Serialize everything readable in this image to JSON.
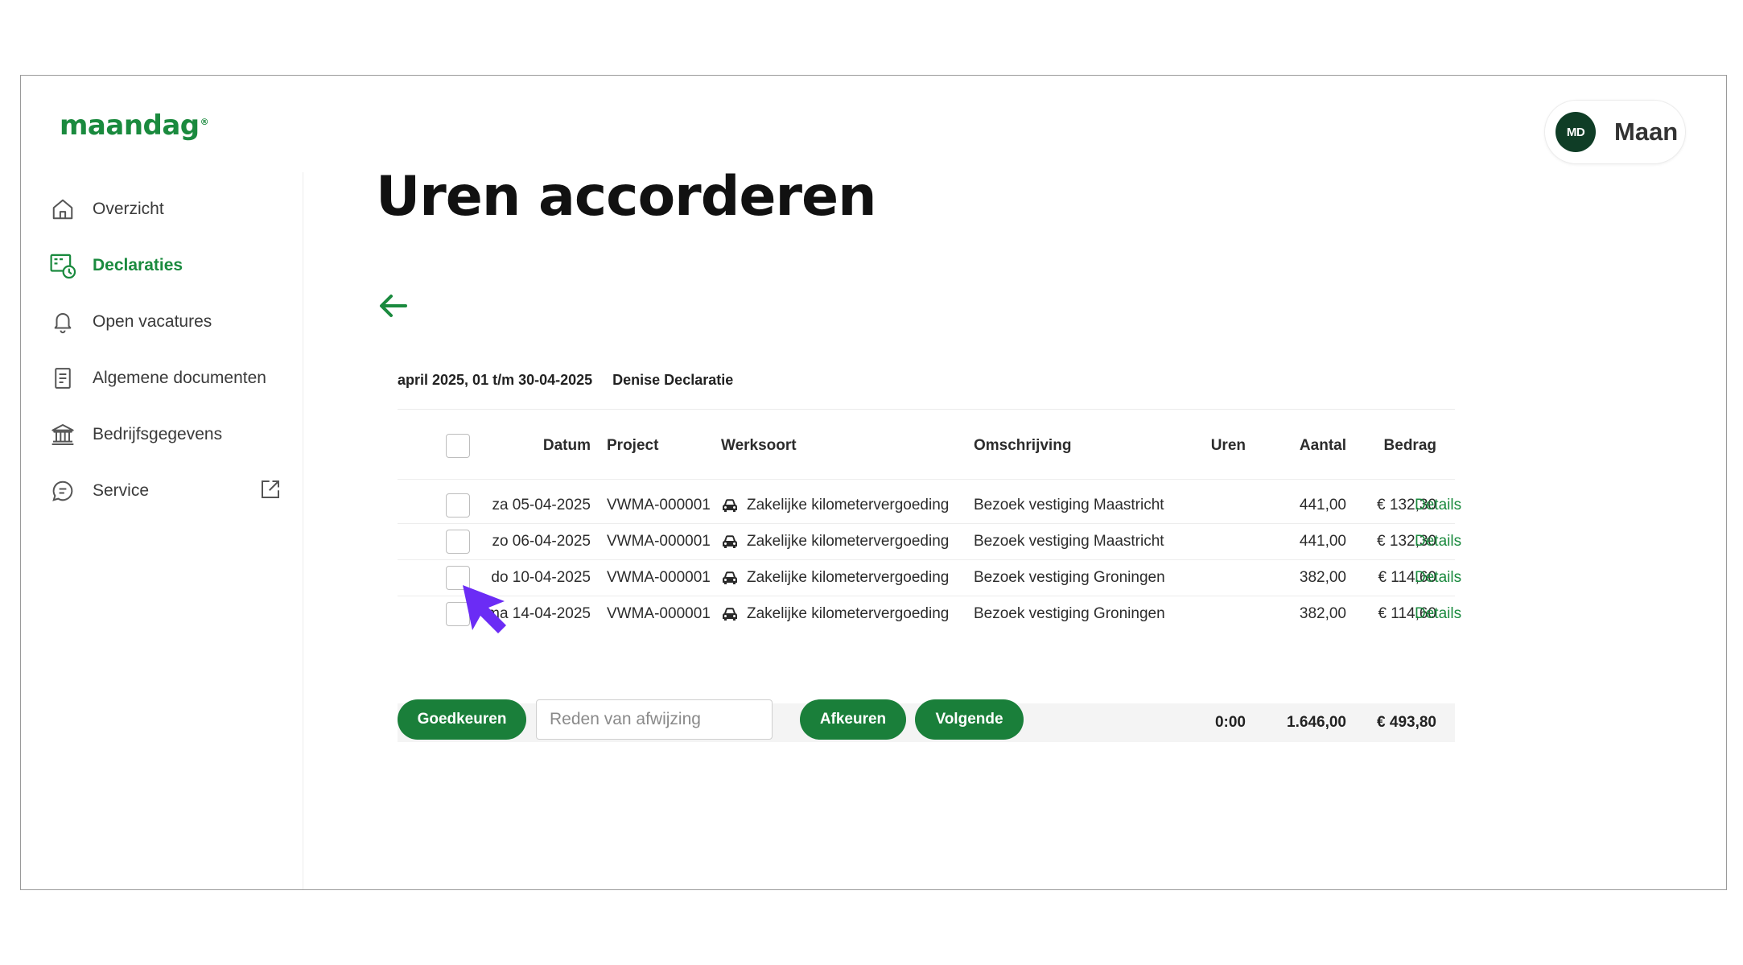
{
  "app": {
    "logo": "maandag",
    "logo_mark": "®",
    "user": {
      "initials": "MD",
      "name": "Maan"
    }
  },
  "sidebar": {
    "items": [
      {
        "label": "Overzicht",
        "icon": "home-icon"
      },
      {
        "label": "Declaraties",
        "icon": "declarations-clock-icon",
        "active": true
      },
      {
        "label": "Open vacatures",
        "icon": "bell-icon"
      },
      {
        "label": "Algemene documenten",
        "icon": "document-icon"
      },
      {
        "label": "Bedrijfsgegevens",
        "icon": "bank-icon"
      },
      {
        "label": "Service",
        "icon": "chat-icon",
        "external": "external-link-icon"
      }
    ]
  },
  "main": {
    "title": "Uren accorderen",
    "period": "april 2025, 01 t/m 30-04-2025",
    "declaration_name": "Denise Declaratie",
    "table": {
      "columns": [
        "Datum",
        "Project",
        "Werksoort",
        "Omschrijving",
        "Uren",
        "Aantal",
        "Bedrag"
      ],
      "rows": [
        {
          "datum": "za 05-04-2025",
          "project": "VWMA-000001",
          "werksoort": "Zakelijke kilometervergoeding",
          "omschrijving": "Bezoek vestiging Maastricht",
          "uren": "",
          "aantal": "441,00",
          "bedrag": "€ 132,30",
          "link": "Details"
        },
        {
          "datum": "zo 06-04-2025",
          "project": "VWMA-000001",
          "werksoort": "Zakelijke kilometervergoeding",
          "omschrijving": "Bezoek vestiging Maastricht",
          "uren": "",
          "aantal": "441,00",
          "bedrag": "€ 132,30",
          "link": "Details"
        },
        {
          "datum": "do 10-04-2025",
          "project": "VWMA-000001",
          "werksoort": "Zakelijke kilometervergoeding",
          "omschrijving": "Bezoek vestiging Groningen",
          "uren": "",
          "aantal": "382,00",
          "bedrag": "€ 114,60",
          "link": "Details"
        },
        {
          "datum": "ma 14-04-2025",
          "project": "VWMA-000001",
          "werksoort": "Zakelijke kilometervergoeding",
          "omschrijving": "Bezoek vestiging Groningen",
          "uren": "",
          "aantal": "382,00",
          "bedrag": "€ 114,60",
          "link": "Details"
        }
      ],
      "totals": {
        "uren": "0:00",
        "aantal": "1.646,00",
        "bedrag": "€ 493,80"
      }
    },
    "actions": {
      "approve": "Goedkeuren",
      "reason_placeholder": "Reden van afwijzing",
      "reject": "Afkeuren",
      "next": "Volgende"
    }
  },
  "colors": {
    "brand_green": "#1a8a3e",
    "button_green": "#1a7f3a",
    "avatar_dark": "#0f3d26",
    "cursor_purple": "#6b2cf5"
  }
}
